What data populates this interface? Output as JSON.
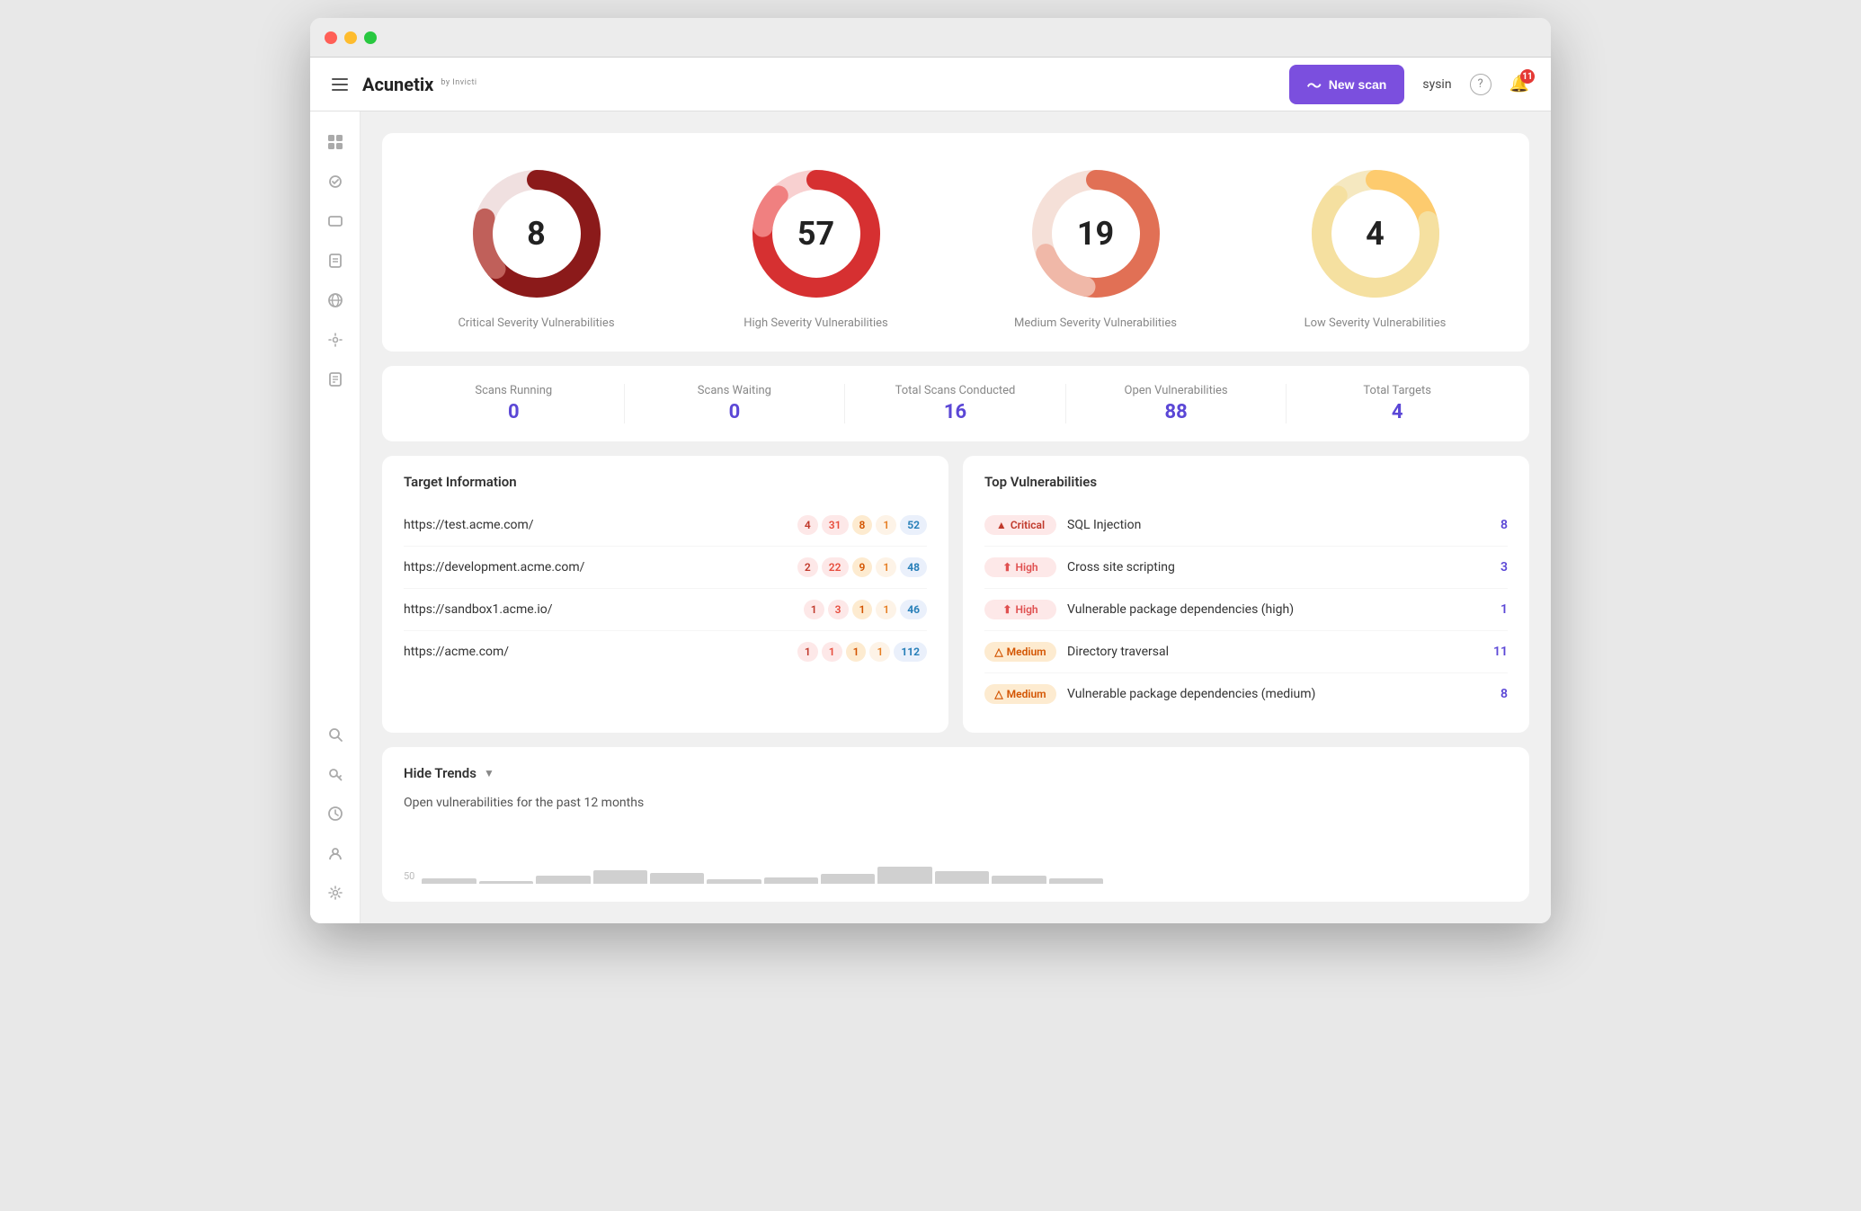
{
  "app": {
    "title": "Acunetix",
    "subtitle": "by Invicti"
  },
  "header": {
    "hamburger_label": "menu",
    "new_scan_label": "New scan",
    "username": "sysin",
    "notification_count": "11"
  },
  "sidebar": {
    "items": [
      {
        "name": "dashboard-icon",
        "icon": "⊞",
        "label": "Dashboard"
      },
      {
        "name": "scans-icon",
        "icon": "✦",
        "label": "Scans"
      },
      {
        "name": "targets-icon",
        "icon": "▭",
        "label": "Targets"
      },
      {
        "name": "reports-icon",
        "icon": "◫",
        "label": "Reports"
      },
      {
        "name": "network-icon",
        "icon": "◎",
        "label": "Network"
      },
      {
        "name": "integrations-icon",
        "icon": "⚙",
        "label": "Integrations"
      },
      {
        "name": "documents-icon",
        "icon": "◻",
        "label": "Documents"
      },
      {
        "name": "discovery-icon",
        "icon": "◎",
        "label": "Discovery"
      },
      {
        "name": "keys-icon",
        "icon": "⚿",
        "label": "Keys"
      },
      {
        "name": "history-icon",
        "icon": "⏱",
        "label": "History"
      },
      {
        "name": "users-icon",
        "icon": "◫",
        "label": "Users"
      },
      {
        "name": "settings2-icon",
        "icon": "⚙",
        "label": "Settings"
      }
    ]
  },
  "vulnerability_cards": [
    {
      "id": "critical",
      "value": "8",
      "label": "Critical Severity Vulnerabilities",
      "color_main": "#8b1a1a",
      "color_secondary": "#c0605a"
    },
    {
      "id": "high",
      "value": "57",
      "label": "High Severity Vulnerabilities",
      "color_main": "#d63031",
      "color_secondary": "#f08080"
    },
    {
      "id": "medium",
      "value": "19",
      "label": "Medium Severity Vulnerabilities",
      "color_main": "#e17055",
      "color_secondary": "#f0b8a8"
    },
    {
      "id": "low",
      "value": "4",
      "label": "Low Severity Vulnerabilities",
      "color_main": "#fdcb6e",
      "color_secondary": "#f5e0a0"
    }
  ],
  "stats": [
    {
      "label": "Scans Running",
      "value": "0"
    },
    {
      "label": "Scans Waiting",
      "value": "0"
    },
    {
      "label": "Total Scans Conducted",
      "value": "16"
    },
    {
      "label": "Open Vulnerabilities",
      "value": "88"
    },
    {
      "label": "Total Targets",
      "value": "4"
    }
  ],
  "target_information": {
    "title": "Target Information",
    "targets": [
      {
        "url": "https://test.acme.com/",
        "critical": "4",
        "high": "31",
        "medium": "8",
        "low": "1",
        "total": "52"
      },
      {
        "url": "https://development.acme.com/",
        "critical": "2",
        "high": "22",
        "medium": "9",
        "low": "1",
        "total": "48"
      },
      {
        "url": "https://sandbox1.acme.io/",
        "critical": "1",
        "high": "3",
        "medium": "1",
        "low": "1",
        "total": "46"
      },
      {
        "url": "https://acme.com/",
        "critical": "1",
        "high": "1",
        "medium": "1",
        "low": "1",
        "total": "112"
      }
    ]
  },
  "top_vulnerabilities": {
    "title": "Top Vulnerabilities",
    "items": [
      {
        "severity": "Critical",
        "name": "SQL Injection",
        "count": "8"
      },
      {
        "severity": "High",
        "name": "Cross site scripting",
        "count": "3"
      },
      {
        "severity": "High",
        "name": "Vulnerable package dependencies (high)",
        "count": "1"
      },
      {
        "severity": "Medium",
        "name": "Directory traversal",
        "count": "11"
      },
      {
        "severity": "Medium",
        "name": "Vulnerable package dependencies (medium)",
        "count": "8"
      }
    ]
  },
  "trends": {
    "hide_label": "Hide Trends",
    "subtitle": "Open vulnerabilities for the past 12 months",
    "y_axis_label": "50"
  }
}
